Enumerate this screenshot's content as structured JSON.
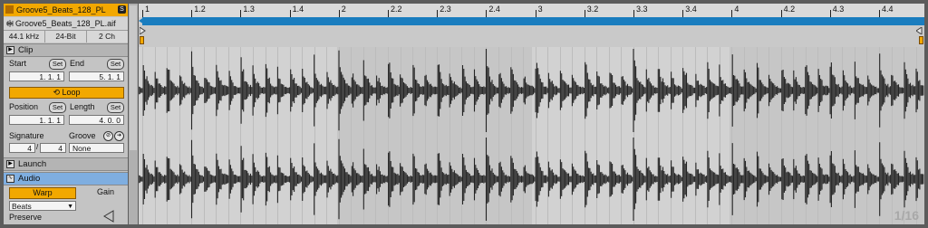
{
  "clip_name": "Groove5_Beats_128_PL",
  "file_name": "Groove5_Beats_128_PL.aif",
  "specs": [
    "44.1 kHz",
    "24-Bit",
    "2 Ch"
  ],
  "clip_section": "Clip",
  "start_label": "Start",
  "end_label": "End",
  "set_label": "Set",
  "start_value": "1.   1.   1",
  "end_value": "5.   1.   1",
  "loop_label": "Loop",
  "position_label": "Position",
  "length_label": "Length",
  "position_value": "1.   1.   1",
  "length_value": "4.   0.   0",
  "signature_label": "Signature",
  "groove_label": "Groove",
  "signature_num": "4",
  "signature_den": "4",
  "groove_value": "None",
  "launch_section": "Launch",
  "audio_section": "Audio",
  "warp_label": "Warp",
  "gain_label": "Gain",
  "warp_mode": "Beats",
  "preserve_label": "Preserve",
  "ruler_labels": [
    "1",
    "1.2",
    "1.3",
    "1.4",
    "2",
    "2.2",
    "2.3",
    "2.4",
    "3",
    "3.2",
    "3.3",
    "3.4",
    "4",
    "4.2",
    "4.3",
    "4.4"
  ],
  "grid_value": "1/16",
  "colors": {
    "accent": "#f2a800",
    "loop": "#1a7dbf",
    "waveform": "#242424"
  }
}
